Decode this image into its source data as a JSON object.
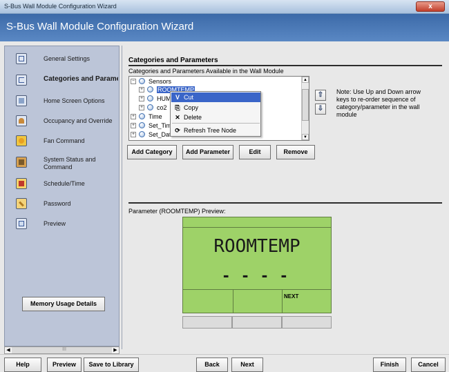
{
  "window": {
    "title": "S-Bus Wall Module Configuration Wizard",
    "close_glyph": "x"
  },
  "header": {
    "title": "S-Bus Wall Module Configuration Wizard"
  },
  "sidebar": {
    "items": [
      {
        "label": "General Settings",
        "icon": "settings-icon"
      },
      {
        "label": "Categories and Parameters",
        "icon": "categories-icon"
      },
      {
        "label": "Home Screen Options",
        "icon": "home-screen-icon"
      },
      {
        "label": "Occupancy and Override",
        "icon": "occupancy-icon"
      },
      {
        "label": "Fan Command",
        "icon": "fan-icon"
      },
      {
        "label": "System Status and Command",
        "icon": "system-status-icon"
      },
      {
        "label": "Schedule/Time",
        "icon": "schedule-icon"
      },
      {
        "label": "Password",
        "icon": "password-icon"
      },
      {
        "label": "Preview",
        "icon": "preview-icon"
      }
    ],
    "memory_button": "Memory Usage Details",
    "scroll_thumb": "III",
    "scroll_left": "◀",
    "scroll_right": "▶"
  },
  "main": {
    "section_title": "Categories and Parameters",
    "tree_caption": "Categories and Parameters Available in the Wall Module",
    "tree": {
      "nodes": [
        {
          "label": "Sensors",
          "expander": "−"
        },
        {
          "label": "ROOMTEMP",
          "expander": "+"
        },
        {
          "label": "HUM",
          "expander": "+"
        },
        {
          "label": "co2",
          "expander": "+"
        },
        {
          "label": "Time",
          "expander": "+"
        },
        {
          "label": "Set_Tim",
          "expander": "+"
        },
        {
          "label": "Set_Dat",
          "expander": "+"
        }
      ],
      "scroll_up": "▲",
      "scroll_down": "▼"
    },
    "context_menu": {
      "items": [
        {
          "label": "Cut",
          "icon": "cut-icon",
          "glyph": "V"
        },
        {
          "label": "Copy",
          "icon": "copy-icon",
          "glyph": "⎘"
        },
        {
          "label": "Delete",
          "icon": "delete-icon",
          "glyph": "✕"
        },
        {
          "label": "Refresh Tree Node",
          "icon": "refresh-icon",
          "glyph": "⟳"
        }
      ]
    },
    "reorder": {
      "up_glyph": "⇧",
      "down_glyph": "⇩",
      "note": "Note: Use Up and Down arrow keys to re-order sequence of category/parameter in the wall module"
    },
    "buttons": {
      "add_category": "Add Category",
      "add_parameter": "Add Parameter",
      "edit": "Edit",
      "remove": "Remove"
    },
    "preview": {
      "caption": "Parameter (ROOMTEMP) Preview:",
      "lcd_text": "ROOMTEMP",
      "lcd_value": "- - - -",
      "softkey_label": "NEXT"
    }
  },
  "footer": {
    "help": "Help",
    "preview": "Preview",
    "save_to_library": "Save to Library",
    "back": "Back",
    "next": "Next",
    "finish": "Finish",
    "cancel": "Cancel"
  }
}
